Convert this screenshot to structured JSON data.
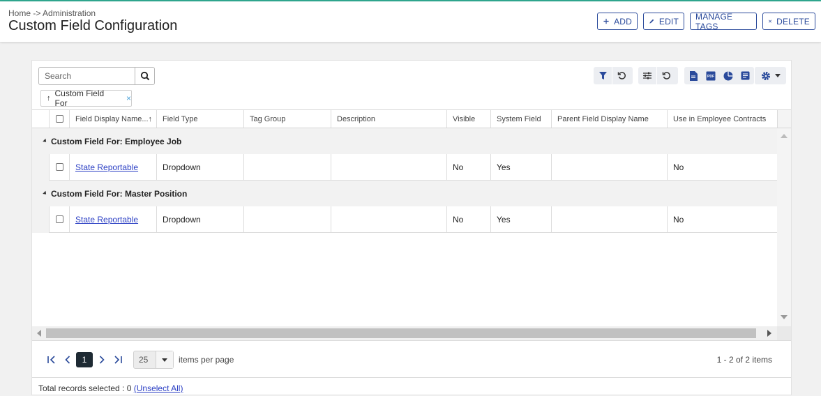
{
  "header": {
    "breadcrumb": "Home -> Administration",
    "title": "Custom Field Configuration",
    "buttons": {
      "add": "ADD",
      "edit": "EDIT",
      "manage_tags": "MANAGE TAGS",
      "delete": "DELETE"
    }
  },
  "colors": {
    "accent": "#2a4a9b",
    "topline": "#2fa88f",
    "link": "#2b3fc4"
  },
  "search": {
    "placeholder": "Search",
    "value": ""
  },
  "toolbar": {
    "icons": [
      "filter-icon",
      "reset-filter-icon",
      "column-settings-icon",
      "reset-columns-icon",
      "excel-export-icon",
      "pdf-export-icon",
      "chart-icon",
      "report-icon",
      "gear-icon"
    ]
  },
  "group_chip": {
    "arrow": "↑",
    "label": "Custom Field For",
    "remove": "×"
  },
  "columns": {
    "field_display_name": "Field Display Name...↑",
    "field_type": "Field Type",
    "tag_group": "Tag Group",
    "description": "Description",
    "visible": "Visible",
    "system_field": "System Field",
    "parent_field_display_name": "Parent Field Display Name",
    "use_in_employee_contracts": "Use in Employee Contracts"
  },
  "groups": [
    {
      "label": "Custom Field For: Employee Job",
      "row": {
        "name": "State Reportable",
        "type": "Dropdown",
        "tag_group": "",
        "description": "",
        "visible": "No",
        "system_field": "Yes",
        "parent": "",
        "contracts": "No"
      }
    },
    {
      "label": "Custom Field For: Master Position",
      "row": {
        "name": "State Reportable",
        "type": "Dropdown",
        "tag_group": "",
        "description": "",
        "visible": "No",
        "system_field": "Yes",
        "parent": "",
        "contracts": "No"
      }
    }
  ],
  "pager": {
    "current_page": "1",
    "page_size": "25",
    "items_per_page_label": "items per page",
    "info": "1 - 2 of 2 items"
  },
  "footer": {
    "selected_text": "Total records selected : 0",
    "unselect_link": "(Unselect All)"
  }
}
